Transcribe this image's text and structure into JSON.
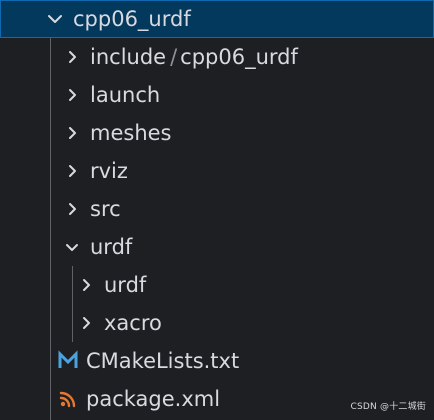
{
  "explorer": {
    "root": {
      "label": "cpp06_urdf",
      "state": "expanded"
    },
    "items": [
      {
        "label_part1": "include",
        "label_part2": "cpp06_urdf",
        "icon": "chevron-right-icon"
      },
      {
        "label": "launch",
        "icon": "chevron-right-icon"
      },
      {
        "label": "meshes",
        "icon": "chevron-right-icon"
      },
      {
        "label": "rviz",
        "icon": "chevron-right-icon"
      },
      {
        "label": "src",
        "icon": "chevron-right-icon"
      },
      {
        "label": "urdf",
        "icon": "chevron-down-icon"
      },
      {
        "label": "urdf",
        "icon": "chevron-right-icon"
      },
      {
        "label": "xacro",
        "icon": "chevron-right-icon"
      },
      {
        "label": "CMakeLists.txt",
        "icon": "cmake-icon"
      },
      {
        "label": "package.xml",
        "icon": "rss-icon"
      }
    ]
  },
  "watermark": {
    "text": "CSDN @十二城街"
  },
  "colors": {
    "background": "#1e1f22",
    "selected_background": "#04395e",
    "selected_border": "#0f6ab2",
    "text": "#d7dae0",
    "cmake_icon": "#4aa3df",
    "xml_icon": "#e37933"
  }
}
